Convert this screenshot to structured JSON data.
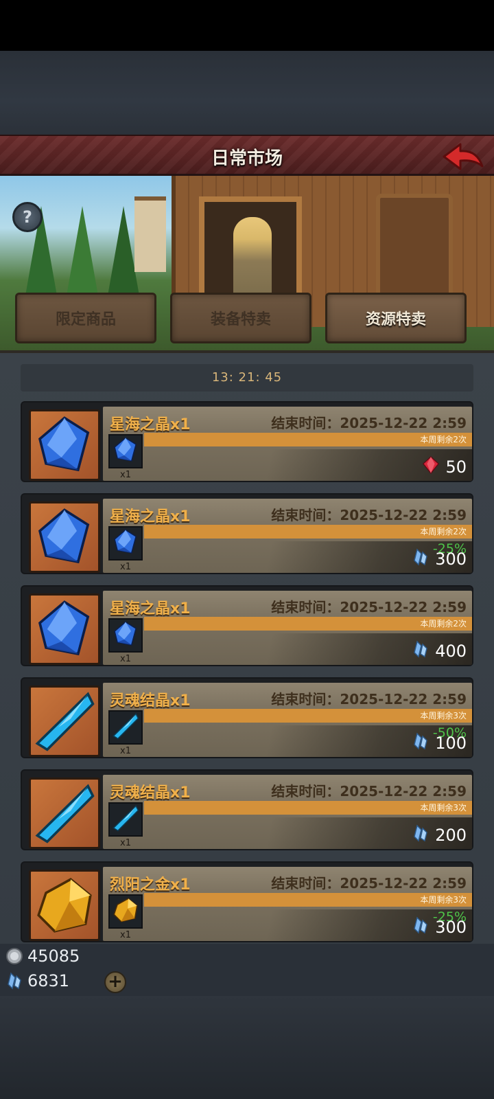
{
  "header": {
    "title": "日常市场"
  },
  "timer": "13: 21: 45",
  "tabs": [
    {
      "label": "限定商品"
    },
    {
      "label": "装备特卖"
    },
    {
      "label": "资源特卖"
    }
  ],
  "items": [
    {
      "name": "星海之晶x1",
      "end_time": "结束时间：2025-12-22 2:59",
      "weekly": "本周剩余2次",
      "qty": "x1",
      "discount": "",
      "price": "50",
      "currency_icon": "red-gem-icon",
      "icon": "blue-crystal-icon"
    },
    {
      "name": "星海之晶x1",
      "end_time": "结束时间：2025-12-22 2:59",
      "weekly": "本周剩余2次",
      "qty": "x1",
      "discount": "-25%",
      "price": "300",
      "currency_icon": "crystal-currency-icon",
      "icon": "blue-crystal-icon"
    },
    {
      "name": "星海之晶x1",
      "end_time": "结束时间：2025-12-22 2:59",
      "weekly": "本周剩余2次",
      "qty": "x1",
      "discount": "",
      "price": "400",
      "currency_icon": "crystal-currency-icon",
      "icon": "blue-crystal-icon"
    },
    {
      "name": "灵魂结晶x1",
      "end_time": "结束时间：2025-12-22 2:59",
      "weekly": "本周剩余3次",
      "qty": "x1",
      "discount": "-50%",
      "price": "100",
      "currency_icon": "crystal-currency-icon",
      "icon": "cyan-crystal-icon"
    },
    {
      "name": "灵魂结晶x1",
      "end_time": "结束时间：2025-12-22 2:59",
      "weekly": "本周剩余3次",
      "qty": "x1",
      "discount": "",
      "price": "200",
      "currency_icon": "crystal-currency-icon",
      "icon": "cyan-crystal-icon"
    },
    {
      "name": "烈阳之金x1",
      "end_time": "结束时间：2025-12-22 2:59",
      "weekly": "本周剩余3次",
      "qty": "x1",
      "discount": "-25%",
      "price": "300",
      "currency_icon": "crystal-currency-icon",
      "icon": "gold-ore-icon"
    }
  ],
  "currency": {
    "silver": "45085",
    "crystal": "6831",
    "add_label": "+"
  },
  "colors": {
    "title_bar": "#5a2424",
    "item_name": "#f0b04a",
    "discount": "#4ec449",
    "weekly_bar": "#d4913a"
  }
}
